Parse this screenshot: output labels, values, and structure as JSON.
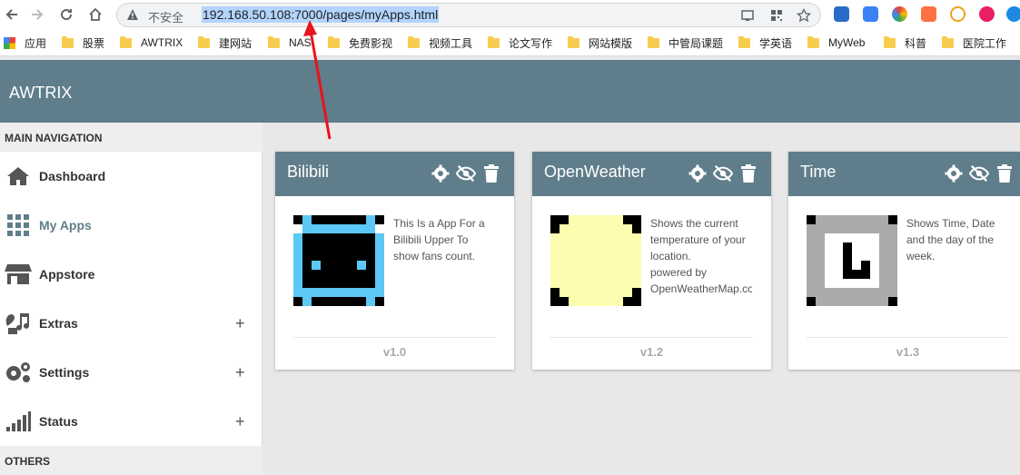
{
  "browser": {
    "insecure_label": "不安全",
    "url": "192.168.50.108:7000/pages/myApps.html"
  },
  "bookmarks": [
    {
      "label": "应用"
    },
    {
      "label": "股票"
    },
    {
      "label": "AWTRIX"
    },
    {
      "label": "建网站"
    },
    {
      "label": "NAS"
    },
    {
      "label": "免费影视"
    },
    {
      "label": "视频工具"
    },
    {
      "label": "论文写作"
    },
    {
      "label": "网站模版"
    },
    {
      "label": "中管局课题"
    },
    {
      "label": "学英语"
    },
    {
      "label": "MyWeb"
    },
    {
      "label": "科普"
    },
    {
      "label": "医院工作"
    }
  ],
  "header": {
    "brand": "AWTRIX"
  },
  "sidebar": {
    "main_header": "MAIN NAVIGATION",
    "items": [
      {
        "label": "Dashboard",
        "icon": "home-icon"
      },
      {
        "label": "My Apps",
        "icon": "grid-icon"
      },
      {
        "label": "Appstore",
        "icon": "store-icon"
      },
      {
        "label": "Extras",
        "icon": "music-icon"
      },
      {
        "label": "Settings",
        "icon": "gears-icon"
      },
      {
        "label": "Status",
        "icon": "signal-icon"
      }
    ],
    "others_header": "OTHERS"
  },
  "apps": [
    {
      "title": "Bilibili",
      "description": "This Is a App For a Bilibili Upper To show fans count.",
      "version": "v1.0"
    },
    {
      "title": "OpenWeather",
      "description": "Shows the current temperature of your location.\npowered by OpenWeatherMap.com",
      "version": "v1.2"
    },
    {
      "title": "Time",
      "description": "Shows Time, Date and the day of the week.",
      "version": "v1.3"
    }
  ],
  "colors": {
    "primary": "#607d8b",
    "bilibili_blue": "#5bc8f5",
    "weather_yellow": "#fdfdb0"
  }
}
